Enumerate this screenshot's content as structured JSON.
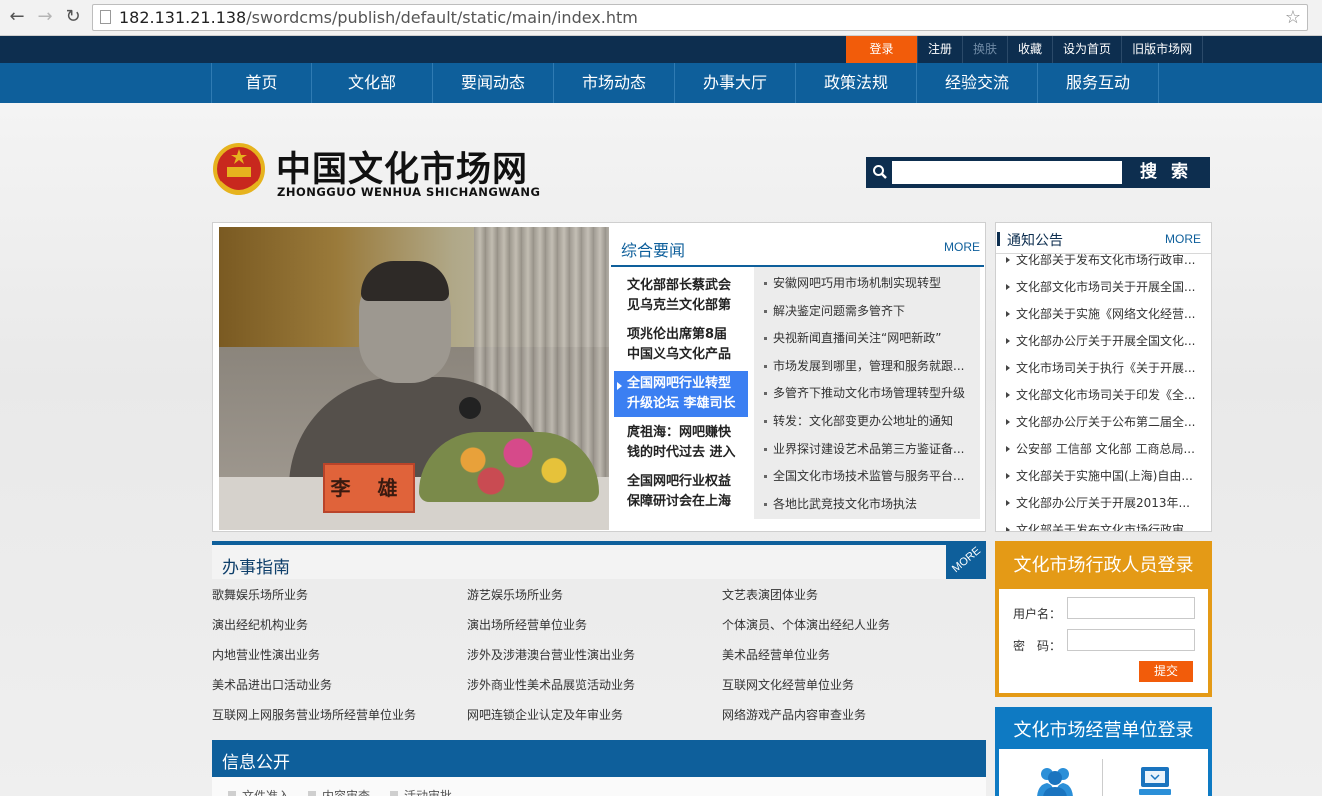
{
  "browser": {
    "url_host": "182.131.21.138",
    "url_path": "/swordcms/publish/default/static/main/index.htm"
  },
  "topbar": {
    "links": [
      "登录",
      "注册",
      "换肤",
      "收藏",
      "设为首页",
      "旧版市场网"
    ]
  },
  "nav": {
    "items": [
      "首页",
      "文化部",
      "要闻动态",
      "市场动态",
      "办事大厅",
      "政策法规",
      "经验交流",
      "服务互动"
    ]
  },
  "header": {
    "title": "中国文化市场网",
    "subtitle": "ZHONGGUO WENHUA SHICHANGWANG",
    "search_button": "搜 索"
  },
  "feature": {
    "name_plate": "李 雄",
    "section_title": "综合要闻",
    "more": "MORE",
    "headlines": [
      {
        "line1": "文化部部长蔡武会",
        "line2": "见乌克兰文化部第"
      },
      {
        "line1": "项兆伦出席第8届",
        "line2": "中国义乌文化产品"
      },
      {
        "line1": "全国网吧行业转型",
        "line2": "升级论坛 李雄司长"
      },
      {
        "line1": "庹祖海：网吧赚快",
        "line2": "钱的时代过去 进入"
      },
      {
        "line1": "全国网吧行业权益",
        "line2": "保障研讨会在上海"
      }
    ],
    "active_headline_index": 2,
    "news": [
      "安徽网吧巧用市场机制实现转型",
      "解决鉴定问题需多管齐下",
      "央视新闻直播间关注“网吧新政”",
      "市场发展到哪里，管理和服务就跟...",
      "多管齐下推动文化市场管理转型升级",
      "转发：文化部变更办公地址的通知",
      "业界探讨建设艺术品第三方鉴证备...",
      "全国文化市场技术监管与服务平台...",
      "各地比武竞技文化市场执法"
    ]
  },
  "notice": {
    "title": "通知公告",
    "more": "MORE",
    "items": [
      "文化部关于发布文化市场行政审...",
      "文化部文化市场司关于开展全国...",
      "文化部关于实施《网络文化经营...",
      "文化部办公厅关于开展全国文化...",
      "文化市场司关于执行《关于开展...",
      "文化部文化市场司关于印发《全...",
      "文化部办公厅关于公布第二届全...",
      "公安部 工信部 文化部 工商总局...",
      "文化部关于实施中国(上海)自由...",
      "文化部办公厅关于开展2013年...",
      "文化部关于发布文化市场行政审..."
    ]
  },
  "guide": {
    "title": "办事指南",
    "more": "MORE",
    "items": [
      "歌舞娱乐场所业务",
      "游艺娱乐场所业务",
      "文艺表演团体业务",
      "演出经纪机构业务",
      "演出场所经营单位业务",
      "个体演员、个体演出经纪人业务",
      "内地营业性演出业务",
      "涉外及涉港澳台营业性演出业务",
      "美术品经营单位业务",
      "美术品进出口活动业务",
      "涉外商业性美术品展览活动业务",
      "互联网文化经营单位业务",
      "互联网上网服务营业场所经营单位业务",
      "网吧连锁企业认定及年审业务",
      "网络游戏产品内容审查业务"
    ]
  },
  "info": {
    "title": "信息公开",
    "tabs": [
      "文件准入",
      "内容审查",
      "活动审批"
    ]
  },
  "admin_login": {
    "title": "文化市场行政人员登录",
    "username_label": "用户名：",
    "password_label": "密　码：",
    "submit": "提交"
  },
  "biz_login": {
    "title": "文化市场经营单位登录"
  },
  "colors": {
    "nav_blue": "#0e5f9b",
    "top_navy": "#0d2e4f",
    "login_orange": "#f25c0a",
    "admin_gold": "#e49a16",
    "biz_blue": "#0e7ac3",
    "active_headline": "#3b7ff2"
  }
}
